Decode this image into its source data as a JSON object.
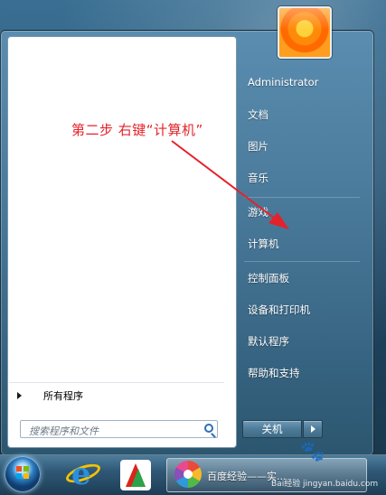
{
  "user": {
    "name": "Administrator"
  },
  "right_menu": {
    "items": [
      "文档",
      "图片",
      "音乐",
      "游戏",
      "计算机",
      "控制面板",
      "设备和打印机",
      "默认程序",
      "帮助和支持"
    ]
  },
  "left_menu": {
    "all_programs": "所有程序",
    "search_placeholder": "搜索程序和文件"
  },
  "shutdown": {
    "label": "关机"
  },
  "annotation": {
    "text": "第二步 右键“计算机”",
    "color": "#e3232b"
  },
  "taskbar": {
    "active_window_label": "百度经验——实..."
  },
  "watermark": {
    "text": "Bai经验 jingyan.baidu.com"
  },
  "icons": {
    "start": "windows-start-orb-icon",
    "browser": "internet-explorer-icon",
    "app": "red-green-app-icon",
    "pinwheel": "baidu-pinwheel-icon",
    "search": "search-icon"
  }
}
